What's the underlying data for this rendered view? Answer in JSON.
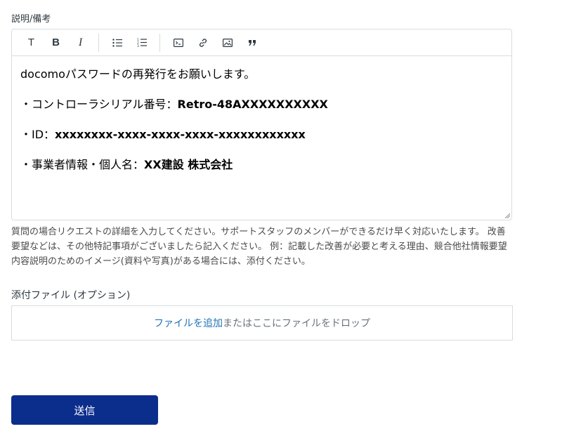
{
  "description": {
    "label": "説明/備考",
    "toolbar": [
      "text-icon",
      "bold-icon",
      "italic-icon",
      "bullet-list-icon",
      "numbered-list-icon",
      "code-icon",
      "link-icon",
      "image-icon",
      "quote-icon"
    ],
    "toolbar_text": {
      "text": "T",
      "bold": "B",
      "italic": "I"
    },
    "content": {
      "line1": "docomoパスワードの再発行をお願いします。",
      "line2_prefix": "・コントローラシリアル番号：",
      "line2_value": "Retro-48AXXXXXXXXXX",
      "line3_prefix": "・ID：",
      "line3_value": "xxxxxxxx-xxxx-xxxx-xxxx-xxxxxxxxxxxx",
      "line4_prefix": "・事業者情報・個人名：",
      "line4_value": "XX建設 株式会社"
    },
    "hint": "質問の場合リクエストの詳細を入力してください。サポートスタッフのメンバーができるだけ早く対応いたします。 改善要望などは、その他特記事項がございましたら記入ください。 例：記載した改善が必要と考える理由、競合他社情報要望内容説明のためのイメージ(資料や写真)がある場合には、添付ください。"
  },
  "attachment": {
    "label": "添付ファイル (オプション)",
    "link_text": "ファイルを追加",
    "rest_text": "またはここにファイルをドロップ"
  },
  "submit_label": "送信"
}
